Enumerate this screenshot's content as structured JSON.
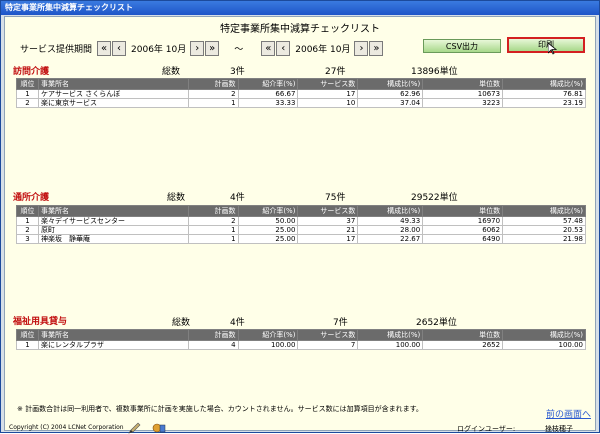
{
  "window_title": "特定事業所集中減算チェックリスト",
  "page_title": "特定事業所集中減算チェックリスト",
  "period": {
    "label": "サービス提供期間",
    "from": "2006年 10月",
    "to": "2006年 10月",
    "separator": "～"
  },
  "buttons": {
    "csv": "CSV出力",
    "print": "印刷"
  },
  "columns": [
    "順位",
    "事業所名",
    "計画数",
    "紹介率(%)",
    "サービス数",
    "構成比(%)",
    "単位数",
    "構成比(%)"
  ],
  "sections": [
    {
      "title": "訪問介護",
      "total_label": "総数",
      "total_count": "3件",
      "total_service": "27件",
      "total_units": "13896単位",
      "rows": [
        {
          "rank": "1",
          "name": "ケアサービス さくらんぼ",
          "plans": "2",
          "rate": "66.67",
          "services": "17",
          "ratio1": "62.96",
          "units": "10673",
          "ratio2": "76.81"
        },
        {
          "rank": "2",
          "name": "楽に東京サービス",
          "plans": "1",
          "rate": "33.33",
          "services": "10",
          "ratio1": "37.04",
          "units": "3223",
          "ratio2": "23.19"
        }
      ]
    },
    {
      "title": "通所介護",
      "total_label": "総数",
      "total_count": "4件",
      "total_service": "75件",
      "total_units": "29522単位",
      "rows": [
        {
          "rank": "1",
          "name": "楽々デイサービスセンター",
          "plans": "2",
          "rate": "50.00",
          "services": "37",
          "ratio1": "49.33",
          "units": "16970",
          "ratio2": "57.48"
        },
        {
          "rank": "2",
          "name": "原町",
          "plans": "1",
          "rate": "25.00",
          "services": "21",
          "ratio1": "28.00",
          "units": "6062",
          "ratio2": "20.53"
        },
        {
          "rank": "3",
          "name": "神楽坂　静華庵",
          "plans": "1",
          "rate": "25.00",
          "services": "17",
          "ratio1": "22.67",
          "units": "6490",
          "ratio2": "21.98"
        }
      ]
    },
    {
      "title": "福祉用具貸与",
      "total_label": "総数",
      "total_count": "4件",
      "total_service": "7件",
      "total_units": "2652単位",
      "rows": [
        {
          "rank": "1",
          "name": "楽にレンタルプラザ",
          "plans": "4",
          "rate": "100.00",
          "services": "7",
          "ratio1": "100.00",
          "units": "2652",
          "ratio2": "100.00"
        }
      ]
    }
  ],
  "note": "※ 計画数合計は同一利用者で、複数事業所に計画を実施した場合、カウントされません。サービス数には加算項目が含まれます。",
  "back_link": "前の画面へ",
  "copyright": "Copyright (C) 2004 LCNet Corporation",
  "login_label": "ログインユーザー:",
  "login_user": "挫枝穂子",
  "colors": {
    "section_title": "#c21010",
    "header_bg": "#6b6b6b",
    "content_bg": "#ffffe8"
  }
}
